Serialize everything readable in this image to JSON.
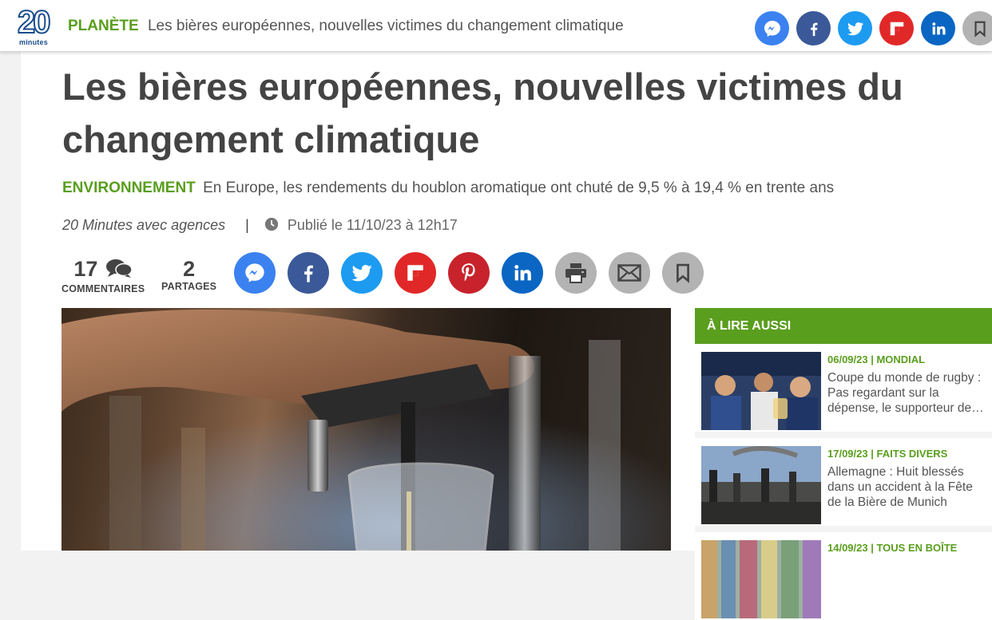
{
  "brand": {
    "logo_number": "20",
    "logo_word": "minutes"
  },
  "topbar": {
    "category": "PLANÈTE",
    "title": "Les bières européennes, nouvelles victimes du changement climatique",
    "share_icons": [
      "messenger-icon",
      "facebook-icon",
      "twitter-icon",
      "flipboard-icon",
      "linkedin-icon",
      "bookmark-icon"
    ]
  },
  "article": {
    "headline": "Les bières européennes, nouvelles victimes du changement climatique",
    "section": "ENVIRONNEMENT",
    "lede": "En Europe, les rendements du houblon aromatique ont chuté de 9,5 % à 19,4 % en trente ans",
    "author": "20 Minutes avec agences",
    "separator": "|",
    "published": "Publié le 11/10/23 à 12h17",
    "comments": {
      "count": "17",
      "label": "COMMENTAIRES"
    },
    "shares": {
      "count": "2",
      "label": "PARTAGES"
    },
    "share_icons": [
      "messenger-icon",
      "facebook-icon",
      "twitter-icon",
      "flipboard-icon",
      "pinterest-icon",
      "linkedin-icon",
      "print-icon",
      "email-icon",
      "bookmark-icon"
    ]
  },
  "colors": {
    "accent_green": "#5a9e1e",
    "messenger": "#3b82f0",
    "facebook": "#3b5998",
    "twitter": "#1d9bf0",
    "flipboard": "#e12828",
    "pinterest": "#c8232c",
    "linkedin": "#0a66c2",
    "grey_button": "#b3b3b3"
  },
  "aside": {
    "header": "À LIRE AUSSI",
    "items": [
      {
        "meta": "06/09/23 | MONDIAL",
        "title": "Coupe du monde de rugby : Pas regardant sur la dépense, le supporteur de…"
      },
      {
        "meta": "17/09/23 | FAITS DIVERS",
        "title": "Allemagne : Huit blessés dans un accident à la Fête de la Bière de Munich"
      },
      {
        "meta": "14/09/23 | TOUS EN BOÎTE",
        "title": ""
      }
    ]
  }
}
